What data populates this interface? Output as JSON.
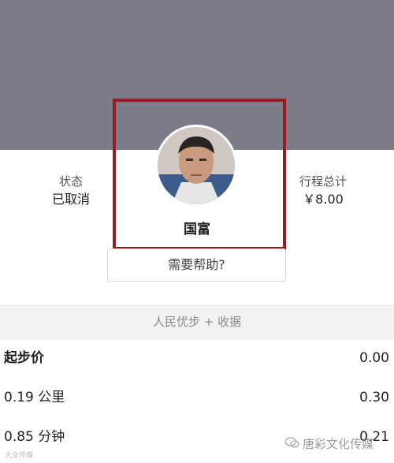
{
  "trip_summary": {
    "status_label": "状态",
    "status_value": "已取消",
    "total_label": "行程总计",
    "total_value": "￥8.00"
  },
  "driver": {
    "name": "国富"
  },
  "help_button_label": "需要帮助?",
  "receipt": {
    "title": "人民优步 + 收据",
    "items": [
      {
        "label": "起步价",
        "value": "0.00"
      },
      {
        "label": "0.19 公里",
        "value": "0.30"
      },
      {
        "label": "0.85 分钟",
        "value": "0.21"
      }
    ]
  },
  "watermarks": {
    "right": "唐彩文化传媒",
    "left": "大众传媒"
  },
  "colors": {
    "header": "#7b7b89",
    "highlight_border": "#9b1c20",
    "receipt_band": "#f2f2f4"
  }
}
